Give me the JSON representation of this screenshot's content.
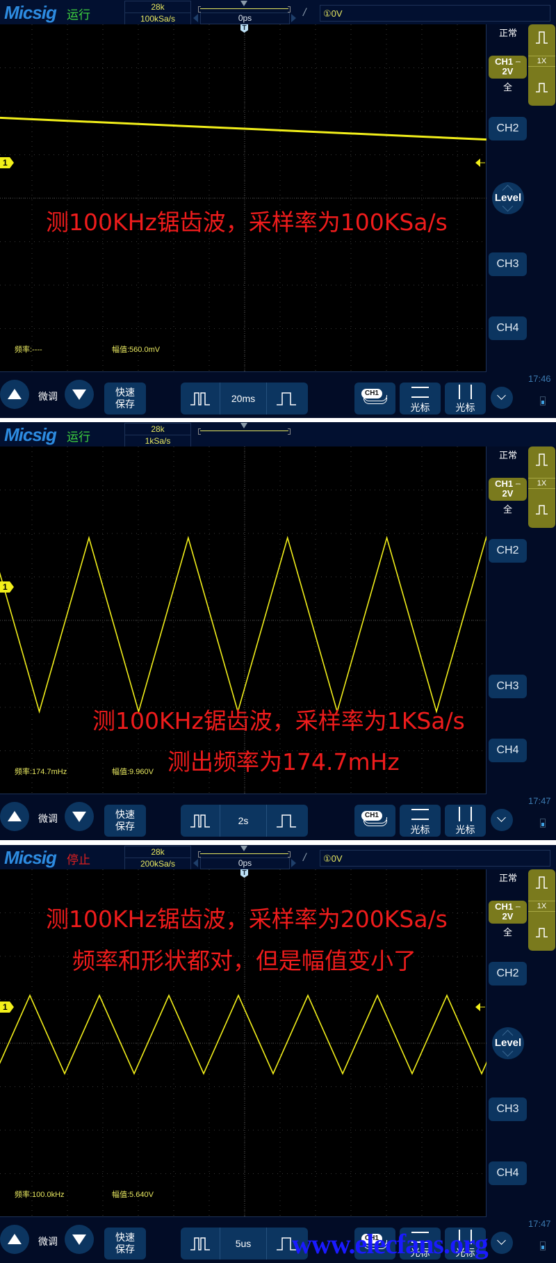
{
  "panels": [
    {
      "brand": "Micsig",
      "run_state": "运行",
      "run_state_color": "#3fd33f",
      "memory_depth": "28k",
      "sample_rate": "100kSa/s",
      "trigger_position": "0ps",
      "trigger_info": "①0V",
      "acq_mode": "正常",
      "ch1_label": "CH1",
      "ch1_scale": "2V",
      "ch1_coupling": "⎓",
      "bandwidth": "全",
      "probe_ratio": "1X",
      "channels": [
        "CH2",
        "CH3",
        "CH4"
      ],
      "level_label": "Level",
      "ch_marker": "1",
      "measurements": {
        "freq": "频率:----",
        "amp": "幅值:560.0mV"
      },
      "annotations": [
        "测100KHz锯齿波，采样率为100KSa/s"
      ],
      "timebase": "20ms",
      "time": "17:46",
      "waveform": {
        "type": "line",
        "description": "slowly descending line",
        "start_div_from_center": 1.85,
        "end_div_from_center": 1.35
      }
    },
    {
      "brand": "Micsig",
      "run_state": "运行",
      "run_state_color": "#3fd33f",
      "memory_depth": "28k",
      "sample_rate": "1kSa/s",
      "acq_mode": "正常",
      "ch1_label": "CH1",
      "ch1_scale": "2V",
      "ch1_coupling": "⎓",
      "bandwidth": "全",
      "probe_ratio": "1X",
      "channels": [
        "CH2",
        "CH3",
        "CH4"
      ],
      "ch_marker": "1",
      "measurements": {
        "freq": "频率:174.7mHz",
        "amp": "幅值:9.960V"
      },
      "annotations": [
        "测100KHz锯齿波，采样率为1KSa/s",
        "测出频率为174.7mHz"
      ],
      "timebase": "2s",
      "time": "17:47",
      "waveform": {
        "type": "triangle",
        "cycles_visible": 4.9,
        "peak_div": 1.9,
        "trough_div": -2.1
      }
    },
    {
      "brand": "Micsig",
      "run_state": "停止",
      "run_state_color": "#e02020",
      "memory_depth": "28k",
      "sample_rate": "200kSa/s",
      "trigger_position": "0ps",
      "trigger_info": "①0V",
      "acq_mode": "正常",
      "ch1_label": "CH1",
      "ch1_scale": "2V",
      "ch1_coupling": "⎓",
      "bandwidth": "全",
      "probe_ratio": "1X",
      "channels": [
        "CH2",
        "CH3",
        "CH4"
      ],
      "level_label": "Level",
      "ch_marker": "1",
      "measurements": {
        "freq": "频率:100.0kHz",
        "amp": "幅值:5.640V"
      },
      "annotations": [
        "测100KHz锯齿波，采样率为200KSa/s",
        "频率和形状都对，但是幅值变小了"
      ],
      "timebase": "5us",
      "time": "17:47",
      "waveform": {
        "type": "triangle",
        "cycles_visible": 7,
        "peak_div": 1.1,
        "trough_div": -0.7
      }
    }
  ],
  "toolbar": {
    "fine_tune": "微调",
    "quick_save_1": "快速",
    "quick_save_2": "保存",
    "cursor": "光标",
    "ch_select": "CH1"
  },
  "watermark": "www.elecfans.org"
}
